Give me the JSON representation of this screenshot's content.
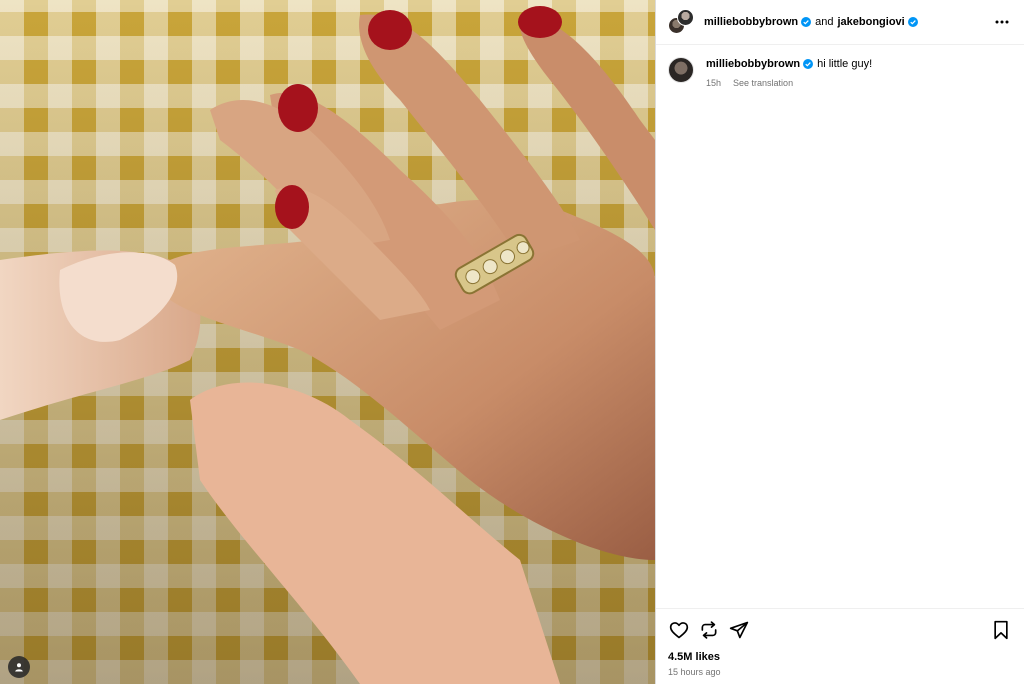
{
  "header": {
    "username_primary": "milliebobbybrown",
    "and_text": "and",
    "username_secondary": "jakebongiovi"
  },
  "caption": {
    "username": "milliebobbybrown",
    "text": "hi little guy!",
    "timestamp": "15h",
    "see_translation": "See translation"
  },
  "engagement": {
    "likes": "4.5M likes",
    "posted": "15 hours ago"
  },
  "icons": {
    "verified": "verified-badge-icon",
    "more": "more-options-icon",
    "like": "heart-icon",
    "repost": "repost-icon",
    "share": "send-icon",
    "save": "bookmark-icon",
    "tags": "user-tag-icon"
  },
  "colors": {
    "verified_blue": "#0095f6",
    "secondary_text": "#737373",
    "divider": "#efefef"
  }
}
